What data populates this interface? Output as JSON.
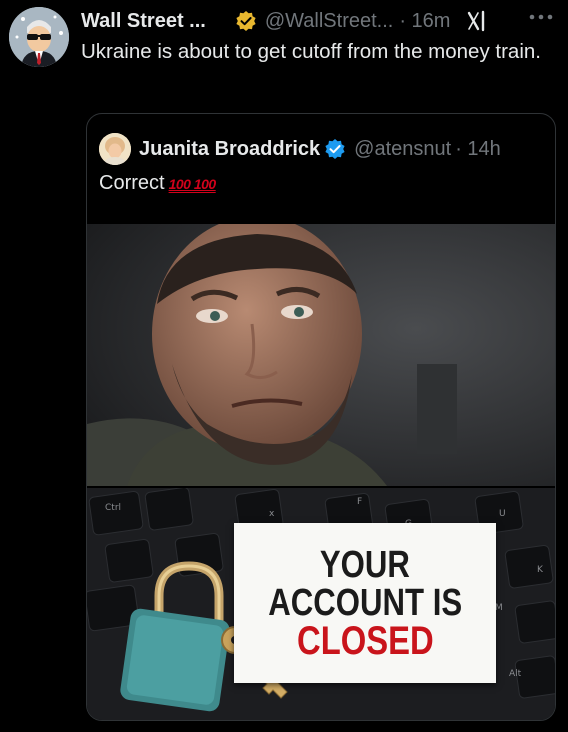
{
  "tweet": {
    "author_name": "Wall Street ...",
    "handle": "@WallStreet...",
    "time": "· 16m",
    "text": "Ukraine is about to get cutoff from the money train."
  },
  "quoted_tweet": {
    "author_name": "Juanita Broaddrick",
    "handle": "@atensnut",
    "time": "· 14h",
    "text": "Correct",
    "emojis": "💯💯",
    "emoji_display": "100 100"
  },
  "image": {
    "keyboard_keys": [
      "Ctrl",
      "x",
      "F",
      "G",
      "U",
      "K",
      "M",
      "Alt"
    ],
    "sign_lines": [
      "YOUR",
      "ACCOUNT IS",
      "CLOSED"
    ]
  },
  "icons": {
    "verified_gold": "verified-gold-badge-icon",
    "verified_blue": "verified-blue-badge-icon",
    "grok": "grok-icon",
    "more": "more-options-icon",
    "padlock": "padlock-icon",
    "key": "key-icon"
  },
  "colors": {
    "background": "#000000",
    "text_primary": "#e7e9ea",
    "text_secondary": "#71767b",
    "gold_badge": "#e8b72f",
    "blue_badge": "#1d9bf0",
    "closed_red": "#c9141b"
  }
}
